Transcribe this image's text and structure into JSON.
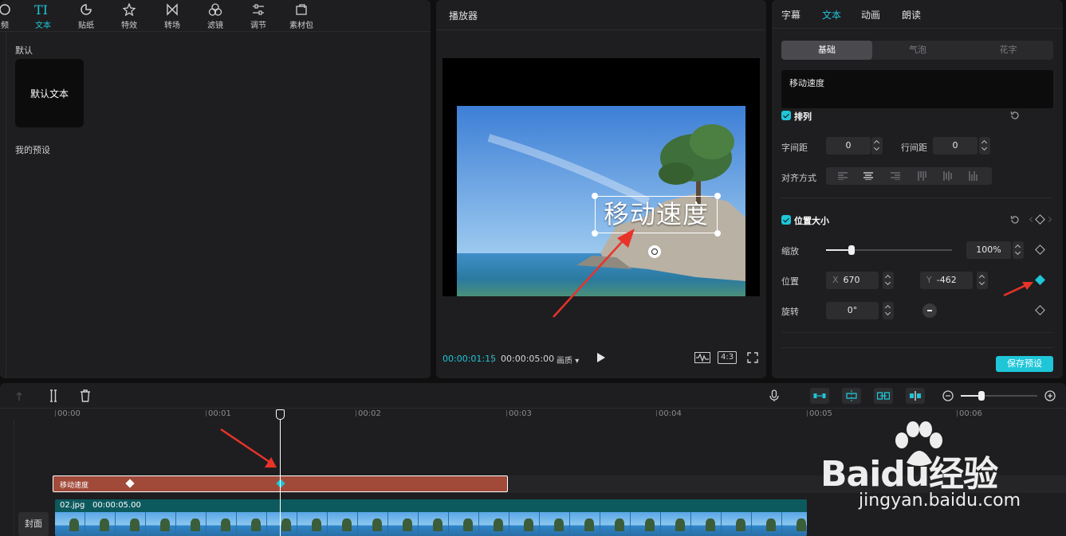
{
  "left_panel": {
    "toolbar": [
      {
        "label": "频",
        "icon": "media-icon",
        "active": false
      },
      {
        "label": "文本",
        "icon": "text-icon",
        "active": true
      },
      {
        "label": "贴纸",
        "icon": "sticker-icon",
        "active": false
      },
      {
        "label": "特效",
        "icon": "effects-icon",
        "active": false
      },
      {
        "label": "转场",
        "icon": "transition-icon",
        "active": false
      },
      {
        "label": "滤镜",
        "icon": "filter-icon",
        "active": false
      },
      {
        "label": "调节",
        "icon": "adjust-icon",
        "active": false
      },
      {
        "label": "素材包",
        "icon": "asset-pack-icon",
        "active": false
      }
    ],
    "default_label": "默认",
    "default_card": "默认文本",
    "my_presets_label": "我的预设"
  },
  "player": {
    "title": "播放器",
    "overlay_text": "移动速度",
    "current_time": "00:00:01:15",
    "total_time": "00:00:05:00",
    "quality": "画质",
    "ratio": "4:3"
  },
  "props": {
    "tabs": [
      "字幕",
      "文本",
      "动画",
      "朗读"
    ],
    "active_tab": "文本",
    "segments": [
      "基础",
      "气泡",
      "花字"
    ],
    "text_value": "移动速度",
    "arrange": {
      "title": "排列",
      "letter_spacing_label": "字间距",
      "letter_spacing": "0",
      "line_spacing_label": "行间距",
      "line_spacing": "0",
      "align_label": "对齐方式"
    },
    "position_size": {
      "title": "位置大小",
      "scale_label": "缩放",
      "scale_value": "100%",
      "scale_fraction": 0.2,
      "position_label": "位置",
      "x_axis": "X",
      "x_value": "670",
      "y_axis": "Y",
      "y_value": "-462",
      "rotate_label": "旋转",
      "rotate_value": "0°"
    },
    "save_preset": "保存预设"
  },
  "timeline": {
    "ruler": [
      "00:00",
      "00:01",
      "00:02",
      "00:03",
      "00:04",
      "00:05",
      "00:06"
    ],
    "text_clip": "移动速度",
    "video_clip_name": "02.jpg",
    "video_clip_duration": "00:00:05.00",
    "cover": "封面",
    "zoom_fraction": 0.27
  },
  "watermark": {
    "logo": "Baidu经验",
    "url": "jingyan.baidu.com"
  },
  "colors": {
    "accent": "#1ec6d8",
    "panel": "#1e1e20",
    "text_clip": "#a14a3a",
    "video_clip": "#0d5a5e",
    "annotation_arrow": "#e8332a"
  }
}
